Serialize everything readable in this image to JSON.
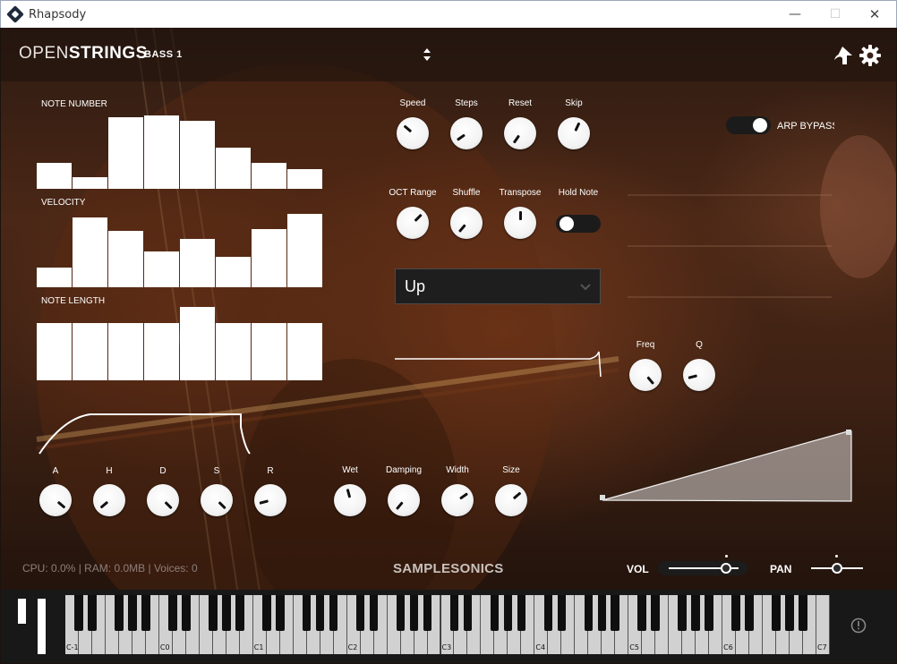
{
  "window": {
    "title": "Rhapsody",
    "min_glyph": "—",
    "max_glyph": "☐",
    "close_glyph": "✕"
  },
  "header": {
    "logo_thin": "OPEN",
    "logo_bold": "STRINGS",
    "preset": "BASS 1",
    "icons": [
      "up-arrow-icon",
      "gear-icon",
      "preset-arrows-icon"
    ]
  },
  "sequencer": {
    "note_number": {
      "label": "NOTE NUMBER",
      "values": [
        0.36,
        0.16,
        1.0,
        1.02,
        0.95,
        0.57,
        0.36,
        0.27
      ]
    },
    "velocity": {
      "label": "VELOCITY",
      "values": [
        0.28,
        0.98,
        0.79,
        0.5,
        0.67,
        0.42,
        0.81,
        1.02
      ]
    },
    "note_length": {
      "label": "NOTE LENGTH",
      "values": [
        0.78,
        0.78,
        0.78,
        0.78,
        1.0,
        0.78,
        0.78,
        0.78
      ]
    }
  },
  "arp": {
    "knobs_row1": [
      {
        "label": "Speed",
        "angle": -50
      },
      {
        "label": "Steps",
        "angle": -125
      },
      {
        "label": "Reset",
        "angle": -145
      },
      {
        "label": "Skip",
        "angle": 25
      }
    ],
    "knobs_row2": [
      {
        "label": "OCT Range",
        "angle": 45
      },
      {
        "label": "Shuffle",
        "angle": -140
      },
      {
        "label": "Transpose",
        "angle": 0
      }
    ],
    "hold_note": {
      "label": "Hold Note",
      "on": false
    },
    "mode": "Up",
    "bypass": {
      "label": "ARP BYPASS",
      "on": true
    }
  },
  "envelope": {
    "knobs": [
      {
        "label": "A",
        "angle": 130
      },
      {
        "label": "H",
        "angle": -130
      },
      {
        "label": "D",
        "angle": 135
      },
      {
        "label": "S",
        "angle": 135
      },
      {
        "label": "R",
        "angle": -105
      }
    ]
  },
  "reverb": {
    "knobs": [
      {
        "label": "Wet",
        "angle": -15
      },
      {
        "label": "Damping",
        "angle": -140
      },
      {
        "label": "Width",
        "angle": 55
      },
      {
        "label": "Size",
        "angle": 50
      }
    ]
  },
  "filter": {
    "knobs": [
      {
        "label": "Freq",
        "angle": 140
      },
      {
        "label": "Q",
        "angle": -105
      }
    ]
  },
  "footer": {
    "status": "CPU: 0.0% | RAM: 0.0MB | Voices: 0",
    "brand": "SAMPLESONICS",
    "vol_label": "VOL",
    "pan_label": "PAN",
    "volume": 0.8,
    "pan": 0.5
  },
  "keyboard": {
    "octave_labels": [
      "C-1",
      "C0",
      "C1",
      "C2",
      "C3",
      "C4",
      "C5",
      "C6",
      "C7"
    ],
    "white_keys": 57,
    "info_icon": "info-icon"
  }
}
